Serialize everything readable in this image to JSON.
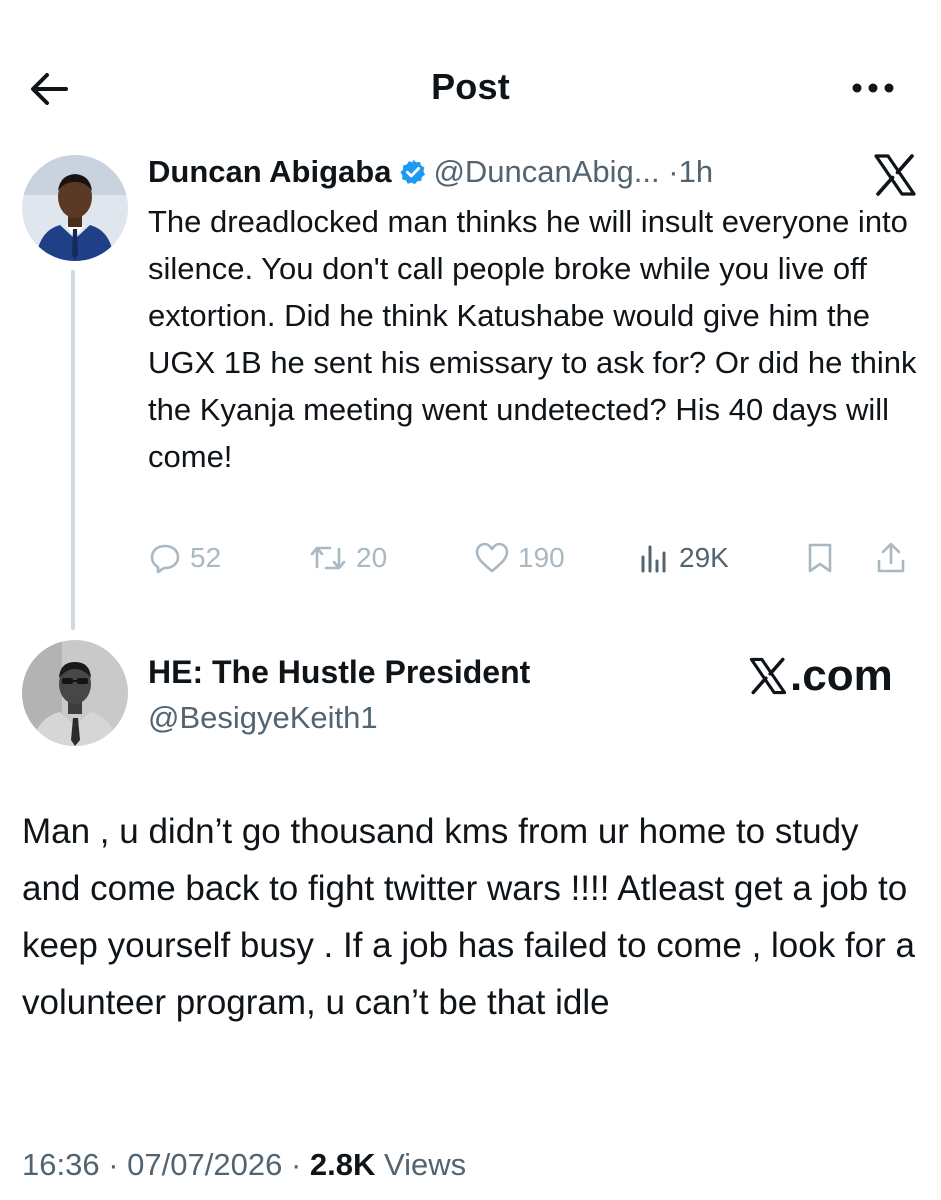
{
  "header": {
    "title": "Post",
    "back_icon": "arrow-left-icon",
    "more_icon": "more-horizontal-icon"
  },
  "quoted_tweet": {
    "author_name": "Duncan Abigaba",
    "verified": true,
    "handle": "@DuncanAbig...",
    "dot": "·",
    "time": "1h",
    "body": "The dreadlocked man thinks he will insult everyone into silence. You don't call people broke while you live off extortion. Did he think Katushabe would give him the UGX 1B he sent his emissary to ask for? Or did he think the Kyanja meeting went undetected? His 40 days will come!",
    "actions": {
      "replies": "52",
      "reposts": "20",
      "likes": "190",
      "views": "29K"
    }
  },
  "reply_tweet": {
    "author_name": "HE: The Hustle President",
    "handle": "@BesigyeKeith1",
    "watermark": ".com",
    "body": "Man , u didn’t go thousand kms from ur home to study and come back to fight twitter wars !!!! Atleast get a job to keep yourself busy . If a job has failed to come , look for a volunteer program, u can’t be that idle"
  },
  "footer": {
    "time": "16:36",
    "sep1": "·",
    "date": "07/07/2026",
    "sep2": "·",
    "views_count": "2.8K",
    "views_label": "Views"
  },
  "colors": {
    "text": "#0f1419",
    "secondary": "#536471",
    "faded_icon": "#aab8c2",
    "verified_blue": "#1d9bf0",
    "thread_line": "#cfd9de"
  }
}
